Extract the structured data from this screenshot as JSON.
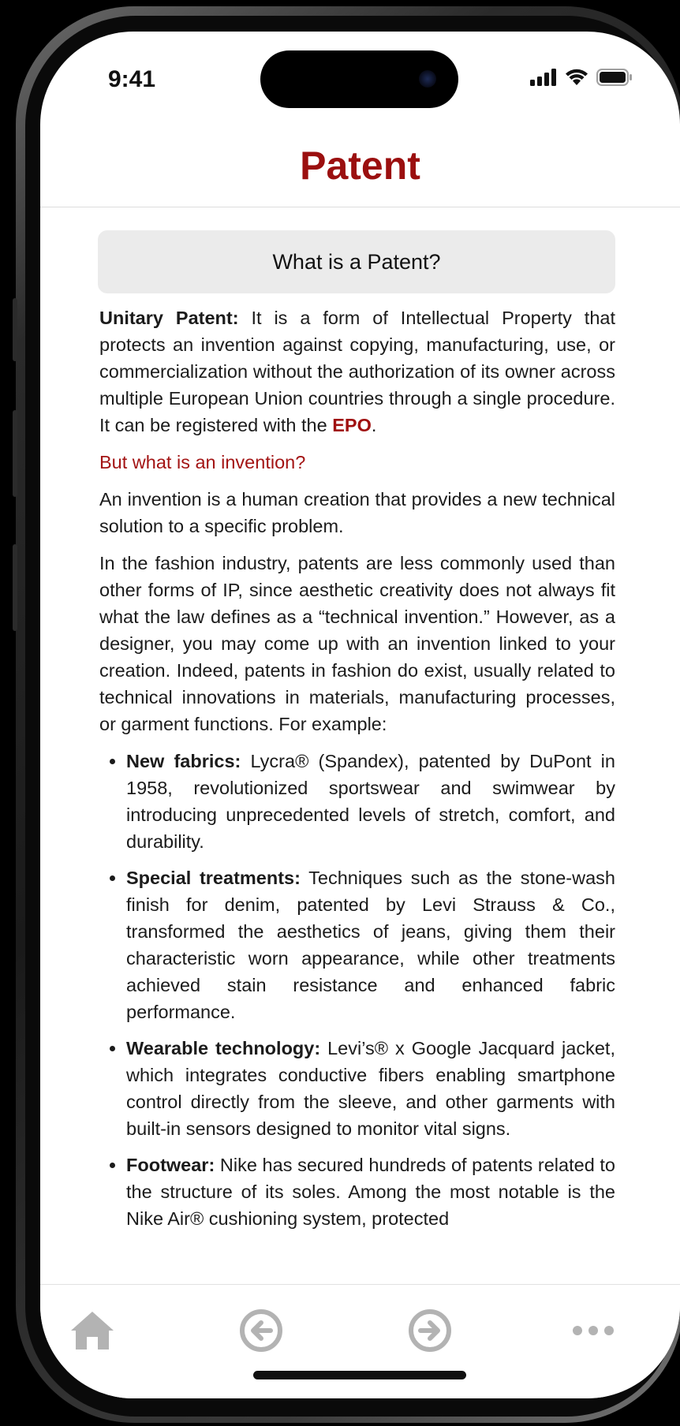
{
  "status_bar": {
    "time": "9:41"
  },
  "header": {
    "title": "Patent"
  },
  "section": {
    "heading": "What is a Patent?"
  },
  "intro": {
    "term": "Unitary Patent:",
    "text": " It is a form of Intellectual Property that protects an invention against copying, manufacturing, use, or commercialization without the authorization of its owner across multiple European Union countries through a single procedure. It can be registered with the ",
    "link": "EPO",
    "end": "."
  },
  "question": "But what is an invention?",
  "paragraphs": [
    "An invention is a human creation that provides a new technical solution to a specific problem.",
    "In the fashion industry, patents are less commonly used than other forms of IP, since aesthetic creativity does not always fit what the law defines as a “technical invention.” However, as a designer, you may come up with an invention linked to your creation. Indeed, patents in fashion do exist, usually related to technical innovations in materials, manufacturing processes, or garment functions. For example:"
  ],
  "examples": [
    {
      "term": "New fabrics:",
      "text": " Lycra® (Spandex), patented by DuPont in 1958, revolutionized sportswear and swimwear by introducing unprecedented levels of stretch, comfort, and durability."
    },
    {
      "term": "Special treatments:",
      "text": " Techniques such as the stone-wash finish for denim, patented by Levi Strauss & Co., transformed the aesthetics of jeans, giving them their characteristic worn appearance, while other treatments achieved stain resistance and enhanced fabric performance."
    },
    {
      "term": "Wearable technology:",
      "text": " Levi’s® x Google Jacquard jacket, which integrates conductive fibers enabling smartphone control directly from the sleeve, and other garments with built-in sensors designed to monitor vital signs."
    },
    {
      "term": "Footwear:",
      "text": " Nike has secured hundreds of patents related to the structure of its soles. Among the most notable is the Nike Air® cushioning system, protected"
    }
  ],
  "bottom_nav": {
    "items": [
      {
        "icon": "home-icon"
      },
      {
        "icon": "back-arrow-icon"
      },
      {
        "icon": "forward-arrow-icon"
      },
      {
        "icon": "more-icon"
      }
    ]
  },
  "colors": {
    "accent": "#9b0f0f",
    "nav_icon": "#b3b3b3"
  }
}
